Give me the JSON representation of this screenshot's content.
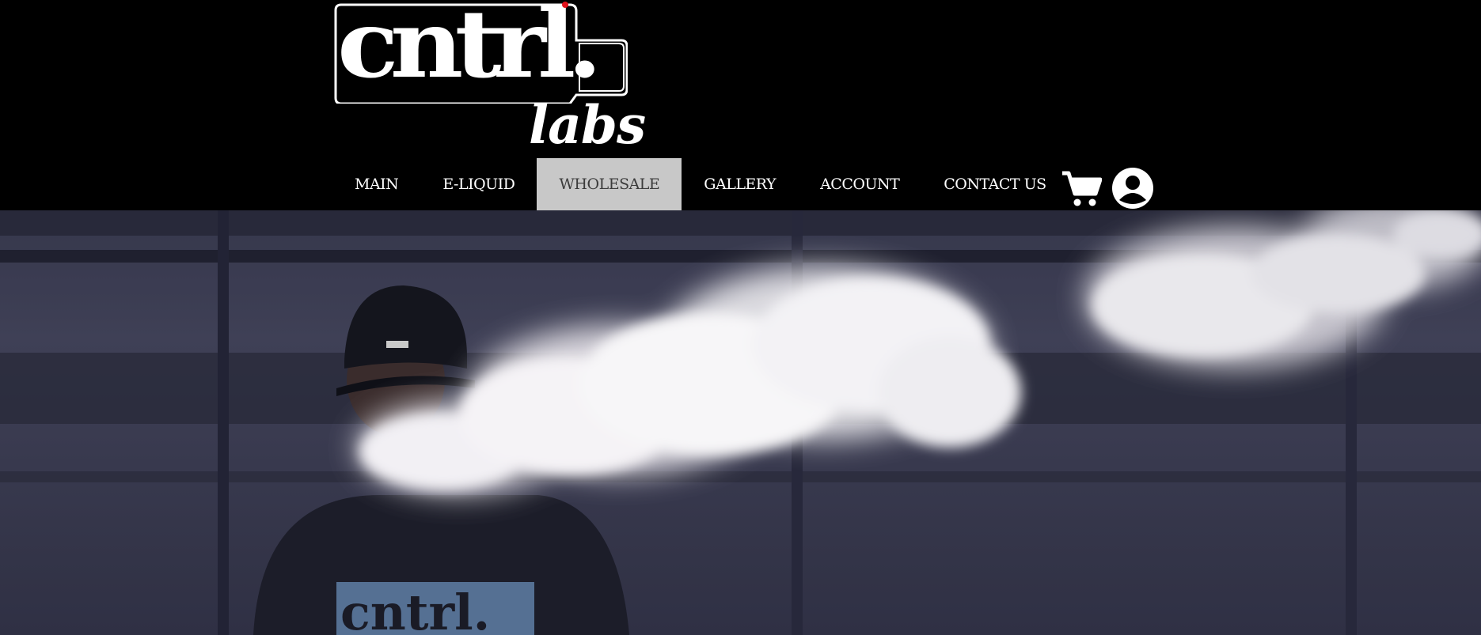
{
  "brand": {
    "main": "cntrl.",
    "sub": "labs",
    "shirt_text": "cntrl."
  },
  "nav": {
    "items": [
      {
        "label": "MAIN"
      },
      {
        "label": "E-LIQUID"
      },
      {
        "label": "WHOLESALE",
        "active": true
      },
      {
        "label": "GALLERY"
      },
      {
        "label": "ACCOUNT"
      },
      {
        "label": "CONTACT US"
      }
    ]
  },
  "icons": {
    "cart": "cart-icon",
    "account": "user-icon"
  },
  "colors": {
    "header_bg": "#000000",
    "active_nav_bg": "#c8c8c8",
    "accent_dot": "#e0101a",
    "text": "#ffffff"
  }
}
